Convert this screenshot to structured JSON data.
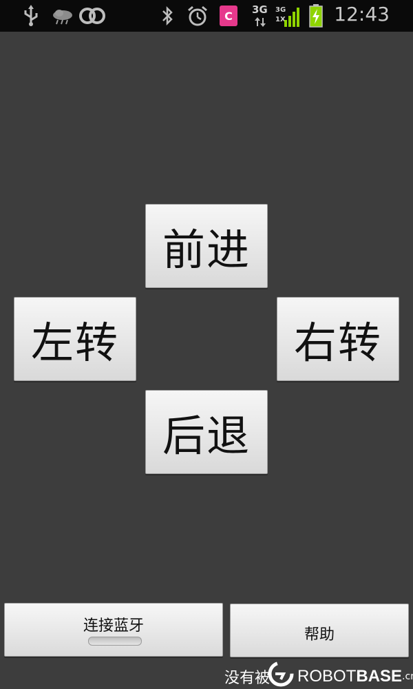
{
  "status_bar": {
    "time": "12:43",
    "network_top": "3G",
    "network_small_top": "3G",
    "network_small_bottom": "1X",
    "notification_badge": "C",
    "icons": [
      "usb-icon",
      "weather-icon",
      "link-icon",
      "bluetooth-icon",
      "alarm-icon",
      "notification-c-icon",
      "data-arrows-icon",
      "signal-icon",
      "battery-charging-icon"
    ]
  },
  "controls": {
    "forward": "前进",
    "left": "左转",
    "right": "右转",
    "backward": "后退"
  },
  "bottom": {
    "connect_label": "连接蓝牙",
    "help_label": "帮助"
  },
  "watermark": {
    "text": "没有被",
    "brand_light": "ROBOT",
    "brand_bold": "BASE",
    "brand_suffix": ".cn"
  },
  "colors": {
    "background": "#3d3d3d",
    "status_bar": "#0a0a0a",
    "notification_pink": "#e6398c",
    "signal_green": "#8fd400",
    "battery_green": "#8fd400"
  }
}
